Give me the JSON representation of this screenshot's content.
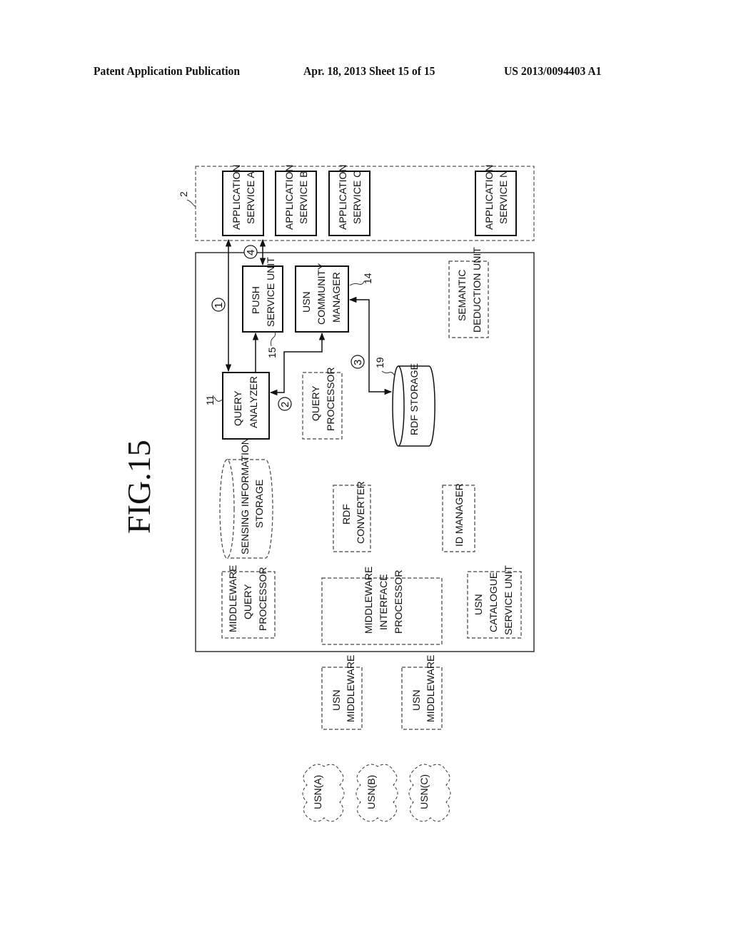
{
  "header": {
    "left": "Patent Application Publication",
    "middle": "Apr. 18, 2013  Sheet 15 of 15",
    "right": "US 2013/0094403 A1"
  },
  "figure": {
    "title": "FIG.15",
    "application_group": {
      "ref": "2",
      "services": [
        {
          "line1": "APPLICATION",
          "line2": "SERVICE A"
        },
        {
          "line1": "APPLICATION",
          "line2": "SERVICE B"
        },
        {
          "line1": "APPLICATION",
          "line2": "SERVICE C"
        },
        {
          "line1": "APPLICATION",
          "line2": "SERVICE N"
        }
      ]
    },
    "server_components": {
      "push_service_unit": {
        "line1": "PUSH",
        "line2": "SERVICE UNIT",
        "ref": "15"
      },
      "usn_community_manager": {
        "line1": "USN",
        "line2": "COMMUNITY",
        "line3": "MANAGER",
        "ref": "14"
      },
      "semantic_deduction_unit": {
        "line1": "SEMANTIC",
        "line2": "DEDUCTION UNIT"
      },
      "query_analyzer": {
        "line1": "QUERY",
        "line2": "ANALYZER",
        "ref": "11"
      },
      "query_processor": {
        "line1": "QUERY",
        "line2": "PROCESSOR"
      },
      "rdf_storage": {
        "line1": "RDF STORAGE",
        "ref": "19"
      },
      "sensing_information_storage": {
        "line1": "SENSING INFORMATION",
        "line2": "STORAGE"
      },
      "rdf_converter": {
        "line1": "RDF",
        "line2": "CONVERTER"
      },
      "id_manager": {
        "line1": "ID MANAGER"
      },
      "middleware_query_processor": {
        "line1": "MIDDLEWARE",
        "line2": "QUERY",
        "line3": "PROCESSOR"
      },
      "middleware_interface_processor": {
        "line1": "MIDDLEWARE",
        "line2": "INTERFACE",
        "line3": "PROCESSOR"
      },
      "usn_catalogue_service_unit": {
        "line1": "USN",
        "line2": "CATALOGUE",
        "line3": "SERVICE UNIT"
      }
    },
    "flow_steps": [
      "1",
      "2",
      "3",
      "4"
    ],
    "middlewares": [
      {
        "line1": "USN",
        "line2": "MIDDLEWARE"
      },
      {
        "line1": "USN",
        "line2": "MIDDLEWARE"
      }
    ],
    "networks": [
      "USN(A)",
      "USN(B)",
      "USN(C)"
    ]
  }
}
